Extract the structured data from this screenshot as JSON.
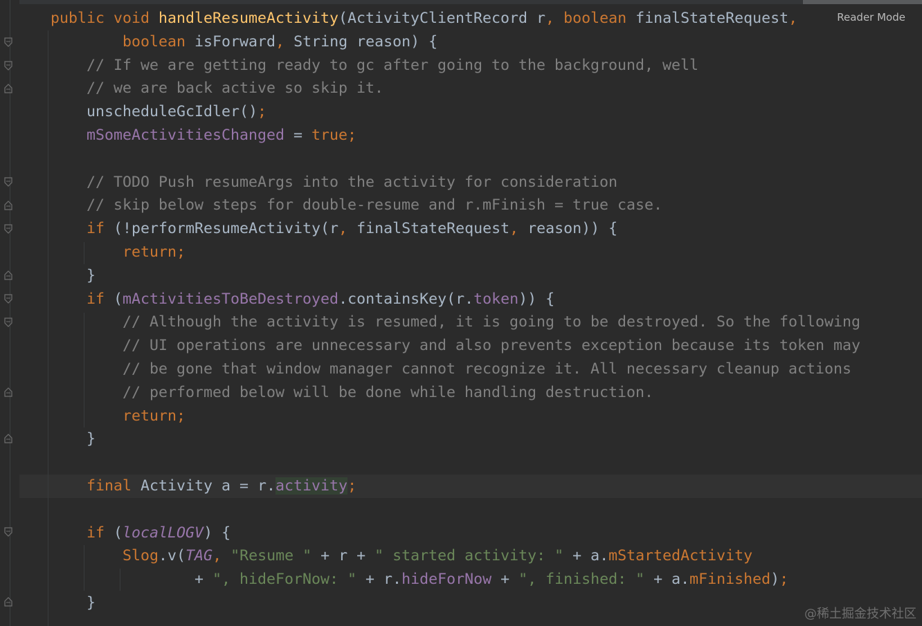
{
  "editor": {
    "reader_mode_label": "Reader Mode",
    "watermark": "@稀土掘金技术社区"
  },
  "code": {
    "l1": {
      "a": "public void ",
      "b": "handleResumeActivity",
      "c": "(ActivityClientRecord r",
      "d": ", ",
      "e": "boolean ",
      "f": "finalStateRequest",
      "g": ","
    },
    "l2": {
      "a": "boolean ",
      "b": "isForward",
      "c": ", ",
      "d": "String reason) {"
    },
    "l3": "// If we are getting ready to gc after going to the background, well",
    "l4": "// we are back active so skip it.",
    "l5": {
      "a": "unscheduleGcIdler()",
      "b": ";"
    },
    "l6": {
      "a": "mSomeActivitiesChanged",
      "b": " = ",
      "c": "true;"
    },
    "l7": "// TODO Push resumeArgs into the activity for consideration",
    "l8": "// skip below steps for double-resume and r.mFinish = true case.",
    "l9": {
      "a": "if ",
      "b": "(!performResumeActivity(r",
      "c": ", ",
      "d": "finalStateRequest",
      "e": ", ",
      "f": "reason)) {"
    },
    "l10": "return;",
    "l11": "}",
    "l12": {
      "a": "if ",
      "b": "(",
      "c": "mActivitiesToBeDestroyed",
      "d": ".containsKey(r.",
      "e": "token",
      "f": ")) {"
    },
    "l13": "// Although the activity is resumed, it is going to be destroyed. So the following",
    "l14": "// UI operations are unnecessary and also prevents exception because its token may",
    "l15": "// be gone that window manager cannot recognize it. All necessary cleanup actions",
    "l16": "// performed below will be done while handling destruction.",
    "l17": "return;",
    "l18": "}",
    "l19": {
      "a": "final ",
      "b": "Activity a = r.",
      "c": "activity",
      ";": ";"
    },
    "l20": {
      "a": "if ",
      "b": "(",
      "c": "localLOGV",
      "d": ") {"
    },
    "l21": {
      "a": "Slog",
      "b": ".v(",
      "c": "TAG",
      ",": ", ",
      "s1": "\"Resume \"",
      "p1": " + r + ",
      "s2": "\" started activity: \"",
      "p2": " + a.",
      "f": "mStartedActivity"
    },
    "l22": {
      "p1": "+ ",
      "s1": "\", hideForNow: \"",
      "p2": " + r.",
      "f1": "hideForNow",
      "p3": " + ",
      "s2": "\", finished: \"",
      "p4": " + a.",
      "f2": "mFinished",
      "e": ")",
      ";": ";"
    },
    "l23": "}"
  }
}
